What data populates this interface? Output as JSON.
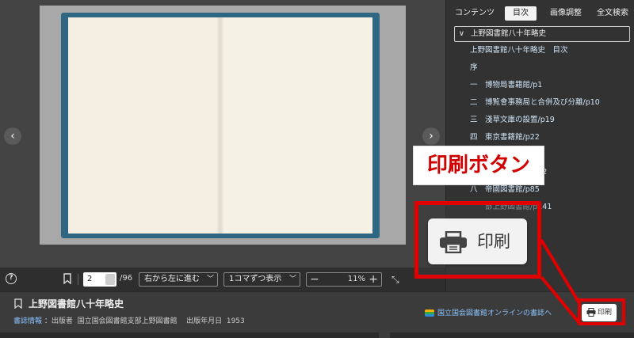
{
  "viewer": {
    "prev_icon": "chevron-left-icon",
    "next_icon": "chevron-right-icon"
  },
  "toolbar": {
    "help_icon_text": "?",
    "page_value": "2",
    "page_total": "/96",
    "direction": "右から左に進む",
    "display_mode": "1コマずつ表示",
    "zoom_minus": "−",
    "zoom_value": "11%",
    "zoom_plus": "+",
    "fullscreen_icon": "expand-icon"
  },
  "side": {
    "tabs": [
      "コンテンツ",
      "目次",
      "画像調整",
      "全文検索"
    ],
    "active_tab": "目次",
    "toc_root": "上野図書館八十年略史",
    "toc_items": [
      "上野図書館八十年略史　目次",
      "序",
      "一　博物局書籍館/p1",
      "二　博覧會事務局と合併及び分離/p10",
      "三　淺草文庫の設置/p19",
      "四　東京書籍館/p22",
      "",
      "　　合併及び分離/p72",
      "八　帝國図書館/p85",
      "　　部上野図書館/p141"
    ]
  },
  "info": {
    "title": "上野図書館八十年略史",
    "meta_link": "書誌情報",
    "meta_publisher_label": "：出版者",
    "meta_publisher": "国立国会図書館支部上野図書館",
    "meta_date_label": "出版年月日",
    "meta_date": "1953",
    "external_link": "国立国会図書館オンラインの書誌へ",
    "print_label": "印刷"
  },
  "callout": {
    "label": "印刷ボタン",
    "zoom_button_label": "印刷",
    "accent_color": "#e00000"
  }
}
